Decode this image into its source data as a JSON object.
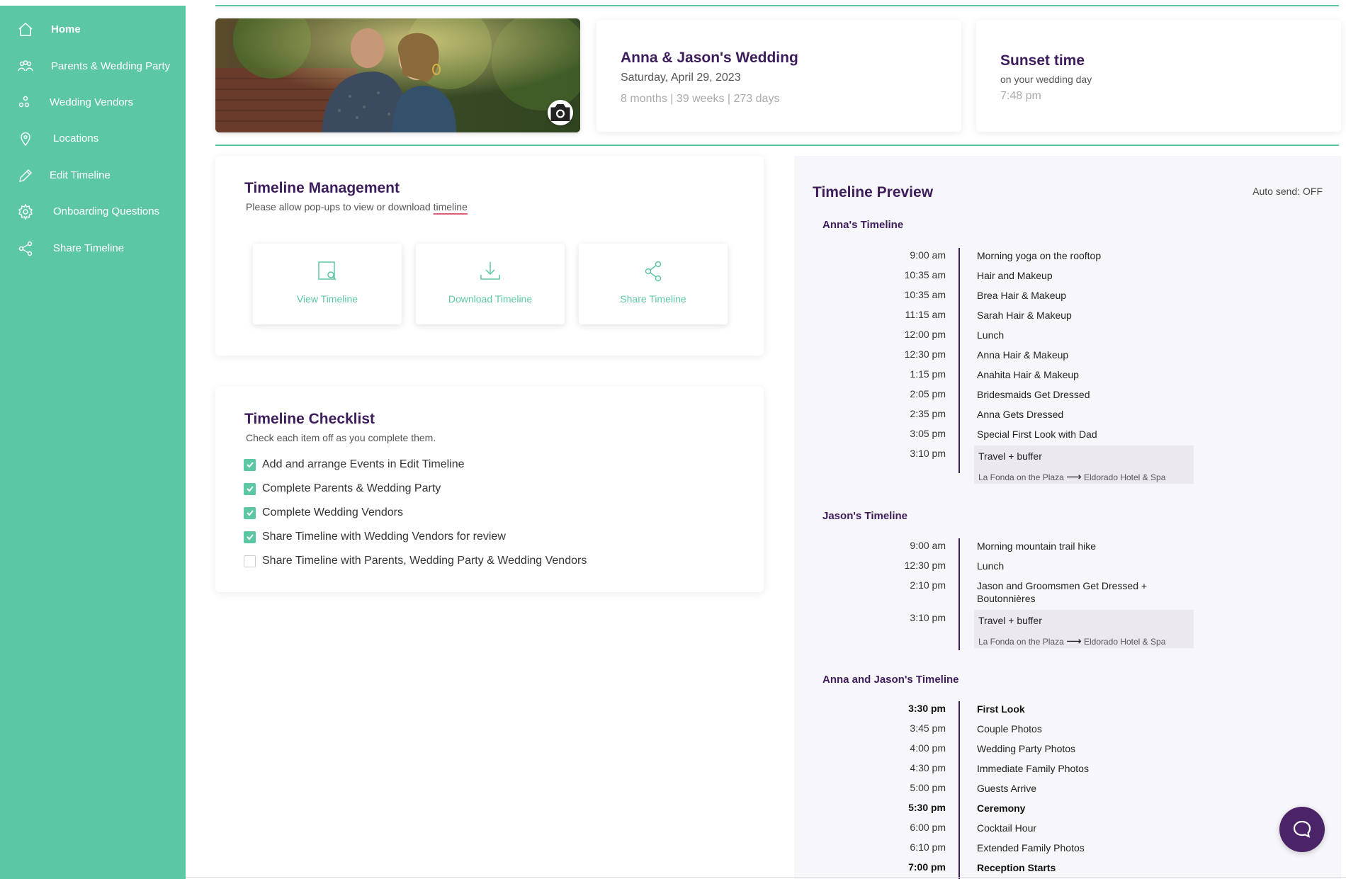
{
  "sidebar": {
    "items": [
      {
        "label": "Home",
        "icon": "home-icon",
        "active": true
      },
      {
        "label": "Parents & Wedding Party",
        "icon": "people-icon"
      },
      {
        "label": "Wedding Vendors",
        "icon": "vendors-icon"
      },
      {
        "label": "Locations",
        "icon": "location-pin-icon"
      },
      {
        "label": "Edit Timeline",
        "icon": "pencil-icon"
      },
      {
        "label": "Onboarding Questions",
        "icon": "gear-icon"
      },
      {
        "label": "Share Timeline",
        "icon": "share-icon"
      }
    ]
  },
  "wedding": {
    "title": "Anna & Jason's Wedding",
    "date": "Saturday, April 29, 2023",
    "countdown": "8 months | 39 weeks | 273 days"
  },
  "sunset": {
    "title": "Sunset time",
    "subtitle": "on your wedding day",
    "time": "7:48 pm"
  },
  "management": {
    "title": "Timeline Management",
    "subtitle_prefix": "Please allow pop-ups to view or download ",
    "subtitle_link": "timeline",
    "actions": [
      {
        "label": "View Timeline",
        "icon": "view-document-icon"
      },
      {
        "label": "Download Timeline",
        "icon": "download-icon"
      },
      {
        "label": "Share Timeline",
        "icon": "share-icon"
      }
    ]
  },
  "checklist": {
    "title": "Timeline Checklist",
    "subtitle": "Check each item off as you complete them.",
    "items": [
      {
        "label": "Add and arrange Events in Edit Timeline",
        "checked": true
      },
      {
        "label": "Complete Parents & Wedding Party",
        "checked": true
      },
      {
        "label": "Complete Wedding Vendors",
        "checked": true
      },
      {
        "label": "Share Timeline with Wedding Vendors for review",
        "checked": true
      },
      {
        "label": "Share Timeline with Parents, Wedding Party & Wedding Vendors",
        "checked": false
      }
    ]
  },
  "preview": {
    "title": "Timeline Preview",
    "auto_send": "Auto send: OFF",
    "anna": {
      "heading": "Anna's Timeline",
      "events": [
        {
          "time": "9:00 am",
          "title": "Morning yoga on the rooftop"
        },
        {
          "time": "10:35 am",
          "title": "Hair and Makeup"
        },
        {
          "time": "10:35 am",
          "title": "Brea Hair & Makeup"
        },
        {
          "time": "11:15 am",
          "title": "Sarah Hair & Makeup"
        },
        {
          "time": "12:00 pm",
          "title": "Lunch"
        },
        {
          "time": "12:30 pm",
          "title": "Anna Hair & Makeup"
        },
        {
          "time": "1:15 pm",
          "title": "Anahita Hair & Makeup"
        },
        {
          "time": "2:05 pm",
          "title": "Bridesmaids Get Dressed"
        },
        {
          "time": "2:35 pm",
          "title": "Anna Gets Dressed"
        },
        {
          "time": "3:05 pm",
          "title": "Special First Look with Dad"
        }
      ],
      "travel": {
        "time": "3:10 pm",
        "label": "Travel + buffer",
        "from": "La Fonda on the Plaza",
        "arrow": "⟶",
        "to": "Eldorado Hotel & Spa"
      }
    },
    "jason": {
      "heading": "Jason's Timeline",
      "events": [
        {
          "time": "9:00 am",
          "title": "Morning mountain trail hike"
        },
        {
          "time": "12:30 pm",
          "title": "Lunch"
        },
        {
          "time": "2:10 pm",
          "title": "Jason and Groomsmen Get Dressed + Boutonnières"
        }
      ],
      "travel": {
        "time": "3:10 pm",
        "label": "Travel + buffer",
        "from": "La Fonda on the Plaza",
        "arrow": "⟶",
        "to": "Eldorado Hotel & Spa"
      }
    },
    "joint": {
      "heading": "Anna and Jason's Timeline",
      "events": [
        {
          "time": "3:30 pm",
          "title": "First Look",
          "bold": true
        },
        {
          "time": "3:45 pm",
          "title": "Couple Photos"
        },
        {
          "time": "4:00 pm",
          "title": "Wedding Party Photos"
        },
        {
          "time": "4:30 pm",
          "title": "Immediate Family Photos"
        },
        {
          "time": "5:00 pm",
          "title": "Guests Arrive"
        },
        {
          "time": "5:30 pm",
          "title": "Ceremony",
          "bold": true
        },
        {
          "time": "6:00 pm",
          "title": "Cocktail Hour"
        },
        {
          "time": "6:10 pm",
          "title": "Extended Family Photos"
        },
        {
          "time": "7:00 pm",
          "title": "Reception Starts",
          "bold": true
        }
      ]
    }
  },
  "colors": {
    "accent": "#5cc7a5",
    "brand_purple": "#3e1d5c",
    "chat": "#4a2466"
  }
}
